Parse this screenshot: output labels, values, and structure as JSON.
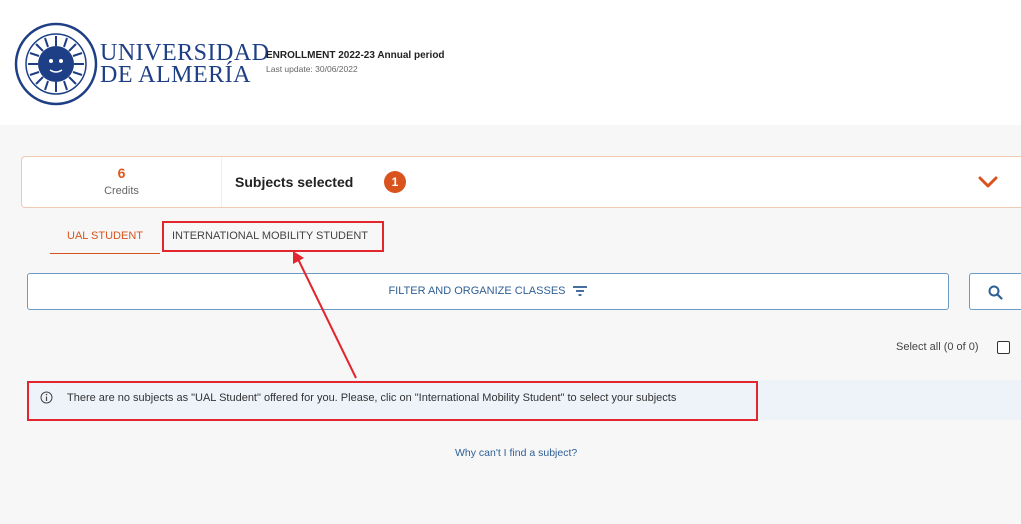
{
  "header": {
    "logo_line1": "UNIVERSIDAD",
    "logo_line2": "DE ALMERÍA",
    "seal_text": "IN LUMINE SAPIENTIA · UNIVERSITAS ALMERIENSIS",
    "enrollment_title": "ENROLLMENT 2022-23 Annual period",
    "last_update": "Last update:  30/06/2022"
  },
  "summary": {
    "credits_value": "6",
    "credits_label": "Credits",
    "subjects_label": "Subjects selected",
    "subjects_count": "1"
  },
  "tabs": [
    {
      "label": "UAL STUDENT",
      "active": true
    },
    {
      "label": "INTERNATIONAL MOBILITY STUDENT",
      "active": false
    }
  ],
  "filter": {
    "label": "FILTER AND ORGANIZE CLASSES"
  },
  "select_all": {
    "label": "Select all (0 of 0)",
    "checked": false
  },
  "info": {
    "message": "There are no subjects as \"UAL Student\" offered for you. Please, clic on \"International Mobility Student\" to select your subjects"
  },
  "help_link": "Why can't I find a subject?",
  "colors": {
    "accent": "#d9531e",
    "brand_blue": "#1e3f85",
    "link_blue": "#2f5f94",
    "annotation_red": "#e3262e"
  },
  "icons": [
    "university-seal",
    "chevron-down-icon",
    "filter-icon",
    "search-icon",
    "info-icon"
  ]
}
